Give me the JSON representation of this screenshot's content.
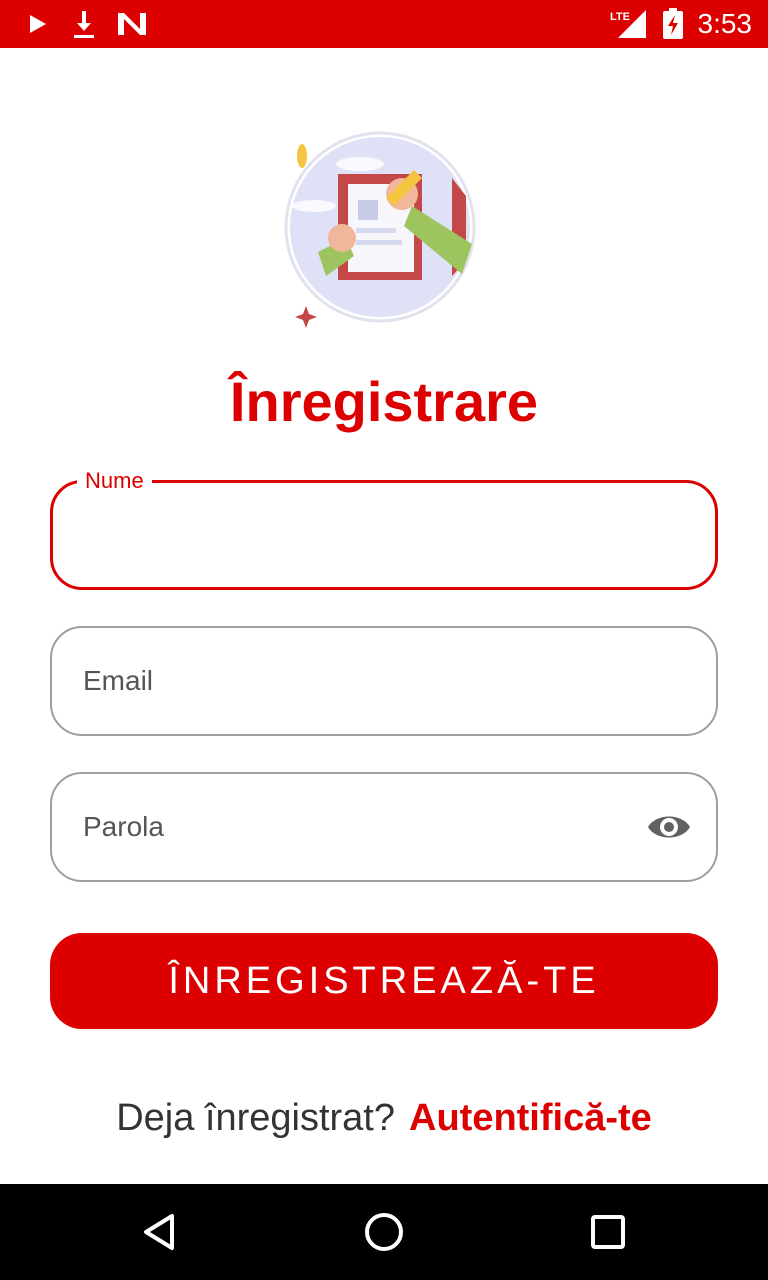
{
  "status_bar": {
    "time": "3:53",
    "network": "LTE",
    "icons": [
      "play-store-icon",
      "download-icon",
      "app-n-icon",
      "lte-signal-icon",
      "battery-charging-icon"
    ]
  },
  "page": {
    "title": "Înregistrare",
    "illustration": "signup-clipboard-illustration"
  },
  "form": {
    "name_label": "Nume",
    "email_placeholder": "Email",
    "password_placeholder": "Parola",
    "password_toggle_icon": "eye-icon",
    "submit_label": "ÎNREGISTREAZĂ-TE"
  },
  "footer": {
    "question": "Deja înregistrat?",
    "login_link": "Autentifică-te"
  },
  "nav_bar": {
    "icons": [
      "back-icon",
      "home-icon",
      "recents-icon"
    ]
  },
  "colors": {
    "accent": "#dd0000",
    "field_border": "#9e9e9e",
    "text_muted": "#555555"
  }
}
